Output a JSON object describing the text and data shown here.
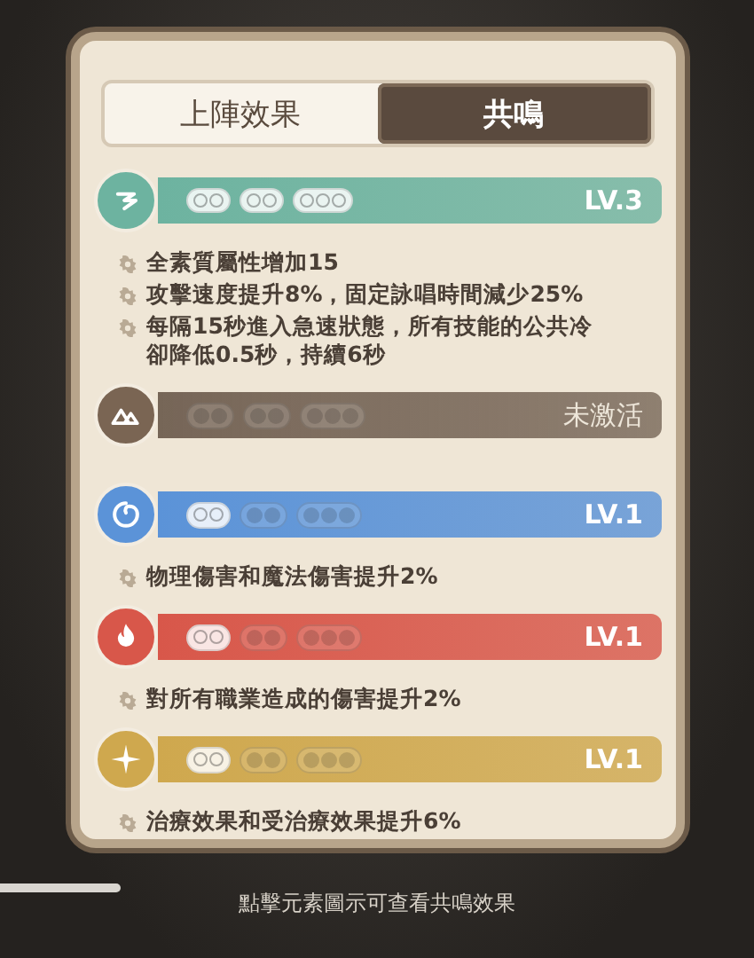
{
  "tabs": [
    {
      "label": "上陣效果",
      "selected": false
    },
    {
      "label": "共鳴",
      "selected": true
    }
  ],
  "resonances": [
    {
      "kind": "wind",
      "color": "#6db3a0",
      "active": true,
      "status": "LV.3",
      "groups": [
        {
          "kind": "pair",
          "active": true
        },
        {
          "kind": "pair",
          "active": true
        },
        {
          "kind": "triple",
          "active": true
        }
      ],
      "effects": [
        "全素質屬性增加15",
        "攻擊速度提升8%，固定詠唱時間減少25%",
        "每隔15秒進入急速狀態，所有技能的公共冷卻降低0.5秒，持續6秒"
      ]
    },
    {
      "kind": "earth",
      "color": "#7a6553",
      "active": false,
      "status": "未激活",
      "groups": [
        {
          "kind": "pair",
          "active": false
        },
        {
          "kind": "pair",
          "active": false
        },
        {
          "kind": "triple",
          "active": false
        }
      ]
    },
    {
      "kind": "water",
      "color": "#5b93d8",
      "active": true,
      "status": "LV.1",
      "groups": [
        {
          "kind": "pair",
          "active": true
        },
        {
          "kind": "pair",
          "active": false
        },
        {
          "kind": "triple",
          "active": false
        }
      ],
      "effects": [
        "物理傷害和魔法傷害提升2%"
      ]
    },
    {
      "kind": "fire",
      "color": "#d8574a",
      "active": true,
      "status": "LV.1",
      "groups": [
        {
          "kind": "pair",
          "active": true
        },
        {
          "kind": "pair",
          "active": false
        },
        {
          "kind": "triple",
          "active": false
        }
      ],
      "effects": [
        "對所有職業造成的傷害提升2%"
      ]
    },
    {
      "kind": "light",
      "color": "#cfa84e",
      "active": true,
      "status": "LV.1",
      "groups": [
        {
          "kind": "pair",
          "active": true
        },
        {
          "kind": "pair",
          "active": false
        },
        {
          "kind": "triple",
          "active": false
        }
      ],
      "effects": [
        "治療效果和受治療效果提升6%"
      ]
    }
  ],
  "hint": "點擊元素圖示可查看共鳴效果"
}
